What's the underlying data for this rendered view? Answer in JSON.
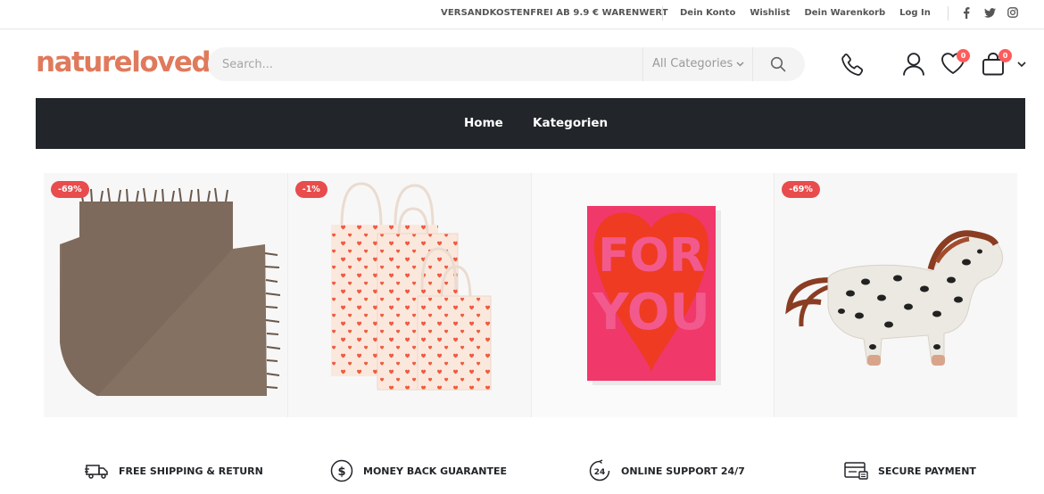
{
  "topbar": {
    "shipping_notice": "VERSANDKOSTENFREI AB 9.9 € WARENWERT",
    "links": [
      "Dein Konto",
      "Wishlist",
      "Dein Warenkorb",
      "Log In"
    ],
    "social_icons": [
      "facebook-icon",
      "twitter-icon",
      "instagram-icon"
    ]
  },
  "header": {
    "logo": "natureloved",
    "search": {
      "placeholder": "Search...",
      "category": "All Categories"
    },
    "wishlist_count": "0",
    "cart_count": "0",
    "icons": [
      "phone-icon",
      "user-icon",
      "heart-icon",
      "shopping-bag-icon"
    ]
  },
  "nav": {
    "items": [
      "Home",
      "Kategorien"
    ]
  },
  "products": [
    {
      "badge": "-69%",
      "image": "brown wool blanket"
    },
    {
      "badge": "-1%",
      "image": "heart print gift bags"
    },
    {
      "badge": "",
      "image": "FOR YOU card"
    },
    {
      "badge": "-69%",
      "image": "spotted toy horse"
    }
  ],
  "features": [
    {
      "label": "FREE SHIPPING & RETURN",
      "icon": "truck-icon"
    },
    {
      "label": "MONEY BACK GUARANTEE",
      "icon": "dollar-icon"
    },
    {
      "label": "ONLINE SUPPORT 24/7",
      "icon": "support-24-icon"
    },
    {
      "label": "SECURE PAYMENT",
      "icon": "payment-icon"
    }
  ],
  "colors": {
    "accent": "#e07a5c",
    "sale": "#e84c4c",
    "nav": "#222529",
    "badge": "#ff5b5b"
  }
}
